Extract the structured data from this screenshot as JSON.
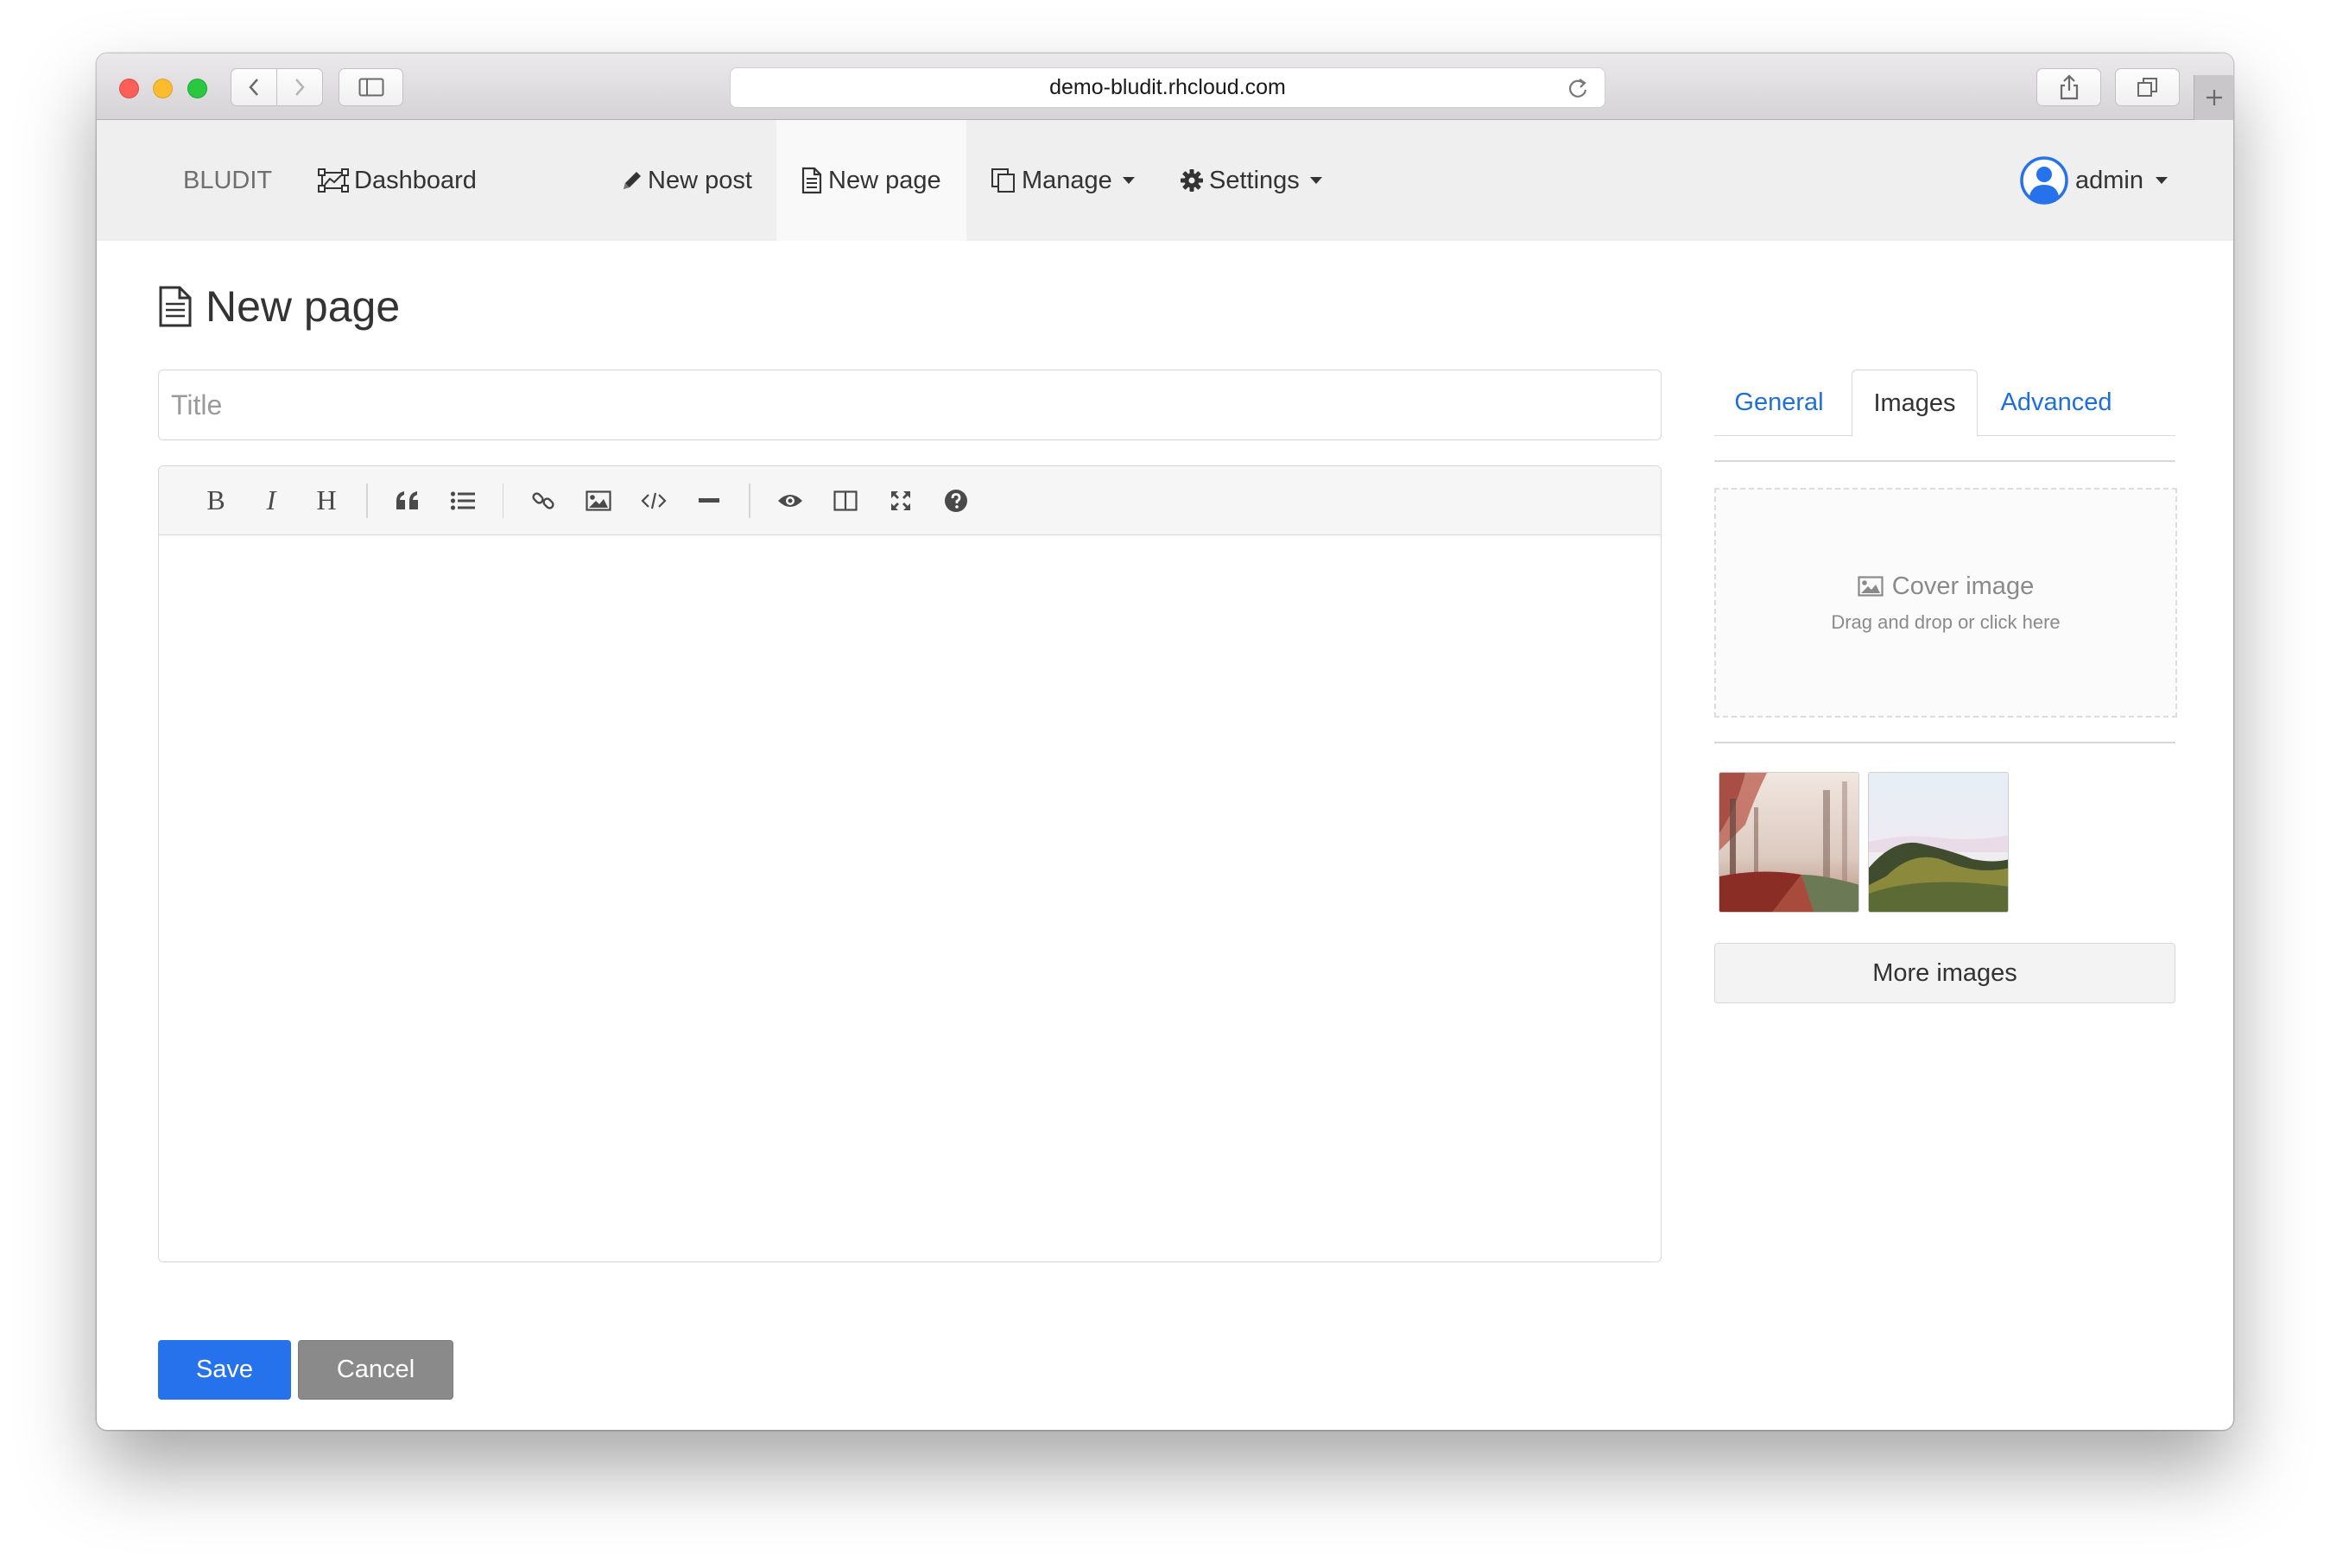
{
  "browser": {
    "url": "demo-bludit.rhcloud.com"
  },
  "navbar": {
    "brand": "BLUDIT",
    "items": [
      {
        "label": "Dashboard",
        "icon": "dashboard-icon"
      },
      {
        "label": "New post",
        "icon": "pencil-icon"
      },
      {
        "label": "New page",
        "icon": "file-icon",
        "active": true
      },
      {
        "label": "Manage",
        "icon": "copy-icon",
        "dropdown": true
      },
      {
        "label": "Settings",
        "icon": "gear-icon",
        "dropdown": true
      }
    ],
    "user": {
      "label": "admin",
      "icon": "user-avatar-icon",
      "dropdown": true
    }
  },
  "main": {
    "page_title": "New page",
    "title_placeholder": "Title",
    "toolbar": [
      "bold-icon",
      "italic-icon",
      "heading-icon",
      "|",
      "quote-icon",
      "list-icon",
      "|",
      "link-icon",
      "image-icon",
      "code-icon",
      "horizontal-rule-icon",
      "|",
      "preview-icon",
      "side-by-side-icon",
      "fullscreen-icon",
      "help-icon"
    ],
    "save_label": "Save",
    "cancel_label": "Cancel"
  },
  "sidebar": {
    "tabs": [
      {
        "label": "General",
        "active": false
      },
      {
        "label": "Images",
        "active": true
      },
      {
        "label": "Advanced",
        "active": false
      }
    ],
    "cover": {
      "title": "Cover image",
      "subtitle": "Drag and drop or click here"
    },
    "images": [
      "forest-photo",
      "hills-photo"
    ],
    "more_images_label": "More images"
  },
  "colors": {
    "primary": "#2672ec",
    "link": "#1f6fd6",
    "cancel": "#8a8a8a",
    "navbar_bg": "#efefef"
  }
}
